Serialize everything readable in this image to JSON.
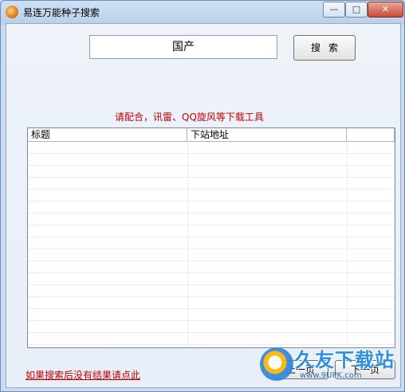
{
  "window": {
    "title": "易连万能种子搜索",
    "min_label": "—",
    "max_label": "□",
    "close_label": "✕"
  },
  "search": {
    "value": "国产",
    "button_label": "搜索"
  },
  "hint_text": "请配合，讯雷、QQ旋风等下载工具",
  "table": {
    "columns": [
      "标题",
      "下站地址",
      ""
    ],
    "rows": []
  },
  "bottom_link": "如果搜索后没有结果请点此",
  "nav": {
    "prev_label": "上一页",
    "next_label": "下一页"
  },
  "watermark": {
    "text": "久友下载站",
    "url": "www.9UPK.com"
  }
}
